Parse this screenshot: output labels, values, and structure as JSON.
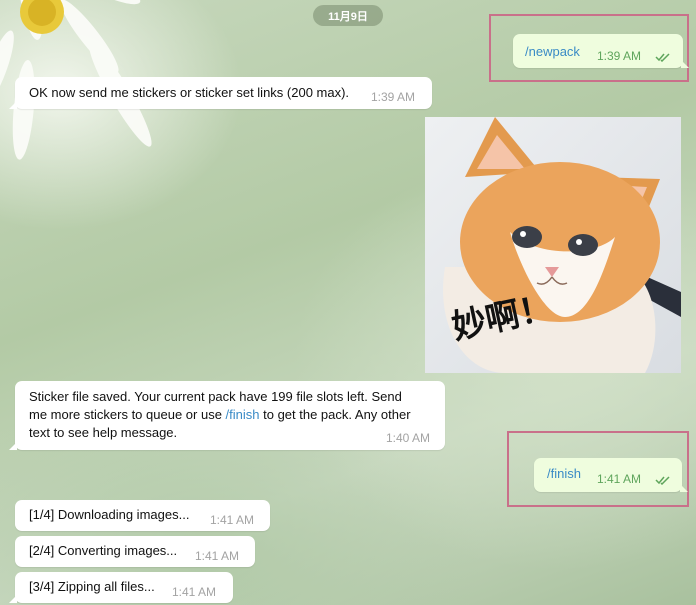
{
  "date": "11月9日",
  "messages": {
    "m1": {
      "text": "/newpack",
      "time": "1:39 AM"
    },
    "m2": {
      "text": "OK now send me stickers or sticker set links (200 max).",
      "time": "1:39 AM"
    },
    "m3": {
      "text": "妙啊！"
    },
    "m4": {
      "line1": "Sticker file saved. Your current pack have 199 file slots left. Send",
      "line2_a": "me more stickers to queue or use ",
      "line2_cmd": "/finish",
      "line2_b": " to get the pack. Any other",
      "line3": "text to see help message.",
      "time": "1:40 AM"
    },
    "m5": {
      "text": "/finish",
      "time": "1:41 AM"
    },
    "m6": {
      "text": "[1/4] Downloading images...",
      "time": "1:41 AM"
    },
    "m7": {
      "text": "[2/4] Converting images...",
      "time": "1:41 AM"
    },
    "m8": {
      "text": "[3/4] Zipping all files...",
      "time": "1:41 AM"
    }
  },
  "colors": {
    "incoming_bubble": "#ffffff",
    "outgoing_bubble": "#effdde",
    "command_link": "#3a8bc6",
    "outgoing_time": "#5fa55c",
    "highlight_box": "#c9708a"
  },
  "icons": {
    "read_receipt": "double-check-icon",
    "wallpaper": "daisy-wallpaper",
    "sticker": "cat-sticker-image"
  }
}
